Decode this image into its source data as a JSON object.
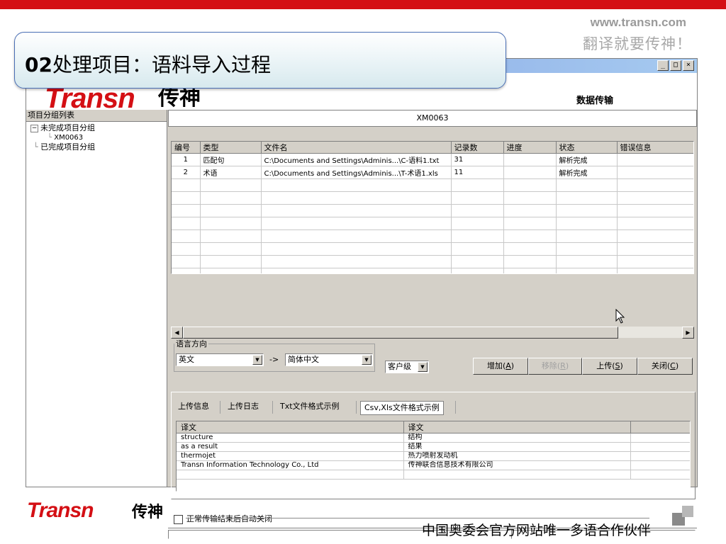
{
  "slide": {
    "url": "www.transn.com",
    "slogan": "翻译就要传神！",
    "title_number": "02",
    "title_text": "处理项目：语料导入过程",
    "footer_logo": "Transn",
    "footer_logo_cn": "传神",
    "footer_text": "中国奥委会官方网站唯一多语合作伙伴"
  },
  "window": {
    "buttons": {
      "minimize": "_",
      "maximize": "□",
      "close": "×"
    },
    "banner": {
      "logo": "Transn",
      "logo_cn": "传神",
      "title": "数据传输"
    }
  },
  "tree": {
    "header": "项目分组列表",
    "items": [
      {
        "label": "未完成项目分组",
        "expander": "−"
      },
      {
        "label": "XM0063"
      },
      {
        "label": "已完成项目分组"
      }
    ]
  },
  "main": {
    "project": "XM0063",
    "grid": {
      "columns": [
        "编号",
        "类型",
        "文件名",
        "记录数",
        "进度",
        "状态",
        "错误信息"
      ],
      "rows": [
        [
          "1",
          "匹配句",
          "C:\\Documents and Settings\\Adminis...\\C-语料1.txt",
          "31",
          "",
          "解析完成",
          ""
        ],
        [
          "2",
          "术语",
          "C:\\Documents and Settings\\Adminis...\\T-术语1.xls",
          "11",
          "",
          "解析完成",
          ""
        ]
      ]
    },
    "language": {
      "legend": "语言方向",
      "source": "英文",
      "arrow": "->",
      "target": "简体中文",
      "level": "客户级"
    },
    "buttons": {
      "add": "增加",
      "add_key": "A",
      "remove": "移除",
      "remove_key": "R",
      "upload": "上传",
      "upload_key": "S",
      "close": "关闭",
      "close_key": "C"
    },
    "tabs": [
      "上传信息",
      "上传日志",
      "Txt文件格式示例",
      "Csv,Xls文件格式示例"
    ],
    "sample": {
      "columns": [
        "译文",
        "译文"
      ],
      "rows": [
        [
          "structure",
          "结构"
        ],
        [
          "as a result",
          "结果"
        ],
        [
          "thermojet",
          "热力喷射发动机"
        ],
        [
          "Transn Information Technology Co., Ltd",
          "传神联合信息技术有限公司"
        ]
      ]
    },
    "auto_close": "正常传输结束后自动关闭"
  }
}
